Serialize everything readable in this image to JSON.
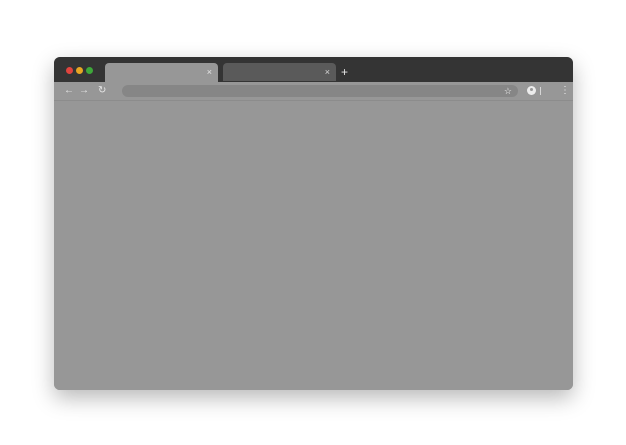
{
  "window": {
    "controls": [
      "close",
      "minimize",
      "maximize"
    ],
    "colors": {
      "close": "#e0443e",
      "minimize": "#e7a623",
      "maximize": "#3ea83a",
      "titlebar": "#343434",
      "chrome": "#979797"
    }
  },
  "tabs": [
    {
      "close_glyph": "×",
      "active": true
    },
    {
      "close_glyph": "×",
      "active": false
    }
  ],
  "new_tab_glyph": "+",
  "toolbar": {
    "back_glyph": "←",
    "forward_glyph": "→",
    "reload_glyph": "↻",
    "bookmark_glyph": "☆",
    "menu_glyph": "⋮",
    "address_value": ""
  }
}
